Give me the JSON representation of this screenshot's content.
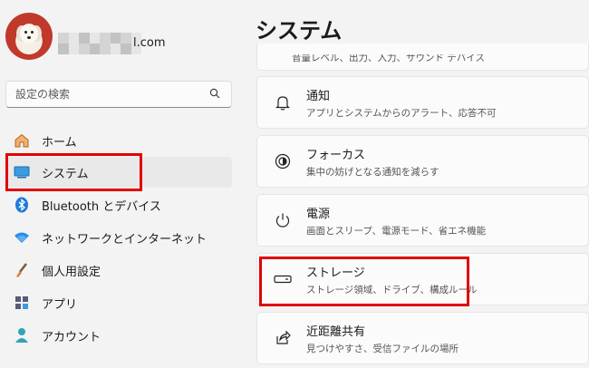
{
  "account": {
    "email_suffix": "l.com"
  },
  "search": {
    "placeholder": "設定の検索"
  },
  "nav": [
    {
      "label": "ホーム"
    },
    {
      "label": "システム"
    },
    {
      "label": "Bluetooth とデバイス"
    },
    {
      "label": "ネットワークとインターネット"
    },
    {
      "label": "個人用設定"
    },
    {
      "label": "アプリ"
    },
    {
      "label": "アカウント"
    }
  ],
  "main": {
    "title": "システム",
    "cut_subtitle": "音量レベル、出力、入力、サウンド デバイス",
    "cards": [
      {
        "title": "通知",
        "subtitle": "アプリとシステムからのアラート、応答不可",
        "icon": "bell-icon"
      },
      {
        "title": "フォーカス",
        "subtitle": "集中の妨げとなる通知を減らす",
        "icon": "focus-icon"
      },
      {
        "title": "電源",
        "subtitle": "画面とスリープ、電源モード、省エネ機能",
        "icon": "power-icon"
      },
      {
        "title": "ストレージ",
        "subtitle": "ストレージ領域、ドライブ、構成ルール",
        "icon": "storage-icon"
      },
      {
        "title": "近距離共有",
        "subtitle": "見つけやすさ、受信ファイルの場所",
        "icon": "share-icon"
      }
    ]
  },
  "colors": {
    "highlight": "#e00000",
    "accent": "#0067c0"
  }
}
